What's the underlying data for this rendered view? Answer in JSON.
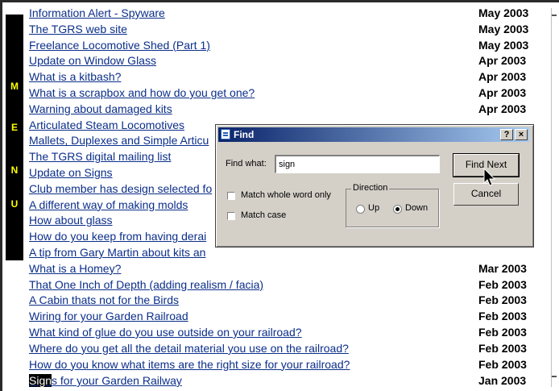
{
  "menu_letters": [
    "M",
    "E",
    "N",
    "U"
  ],
  "articles": [
    {
      "title": "Information Alert - Spyware",
      "date": "May 2003"
    },
    {
      "title": "The TGRS web site",
      "date": "May 2003"
    },
    {
      "title": "Freelance Locomotive Shed (Part 1)",
      "date": "May 2003"
    },
    {
      "title": "Update on Window Glass",
      "date": "Apr 2003"
    },
    {
      "title": "What is a kitbash?",
      "date": "Apr 2003"
    },
    {
      "title": "What is a scrapbox and how do you get one?",
      "date": "Apr 2003"
    },
    {
      "title": "Warning about damaged kits",
      "date": "Apr 2003"
    },
    {
      "title": "Articulated Steam Locomotives",
      "date": ""
    },
    {
      "title": " Mallets, Duplexes and Simple Articu",
      "date": ""
    },
    {
      "title": "The TGRS digital mailing list",
      "date": ""
    },
    {
      "title": "Update on Signs",
      "date": ""
    },
    {
      "title": "Club member has design selected fo",
      "date": ""
    },
    {
      "title": "A different way of making molds",
      "date": ""
    },
    {
      "title": "How about glass",
      "date": ""
    },
    {
      "title": "How do you keep from having derai",
      "date": ""
    },
    {
      "title": "A tip from Gary Martin about kits an",
      "date": ""
    },
    {
      "title": "What is a Homey?",
      "date": "Mar 2003"
    },
    {
      "title": "That One Inch of Depth (adding realism / facia)",
      "date": "Feb 2003"
    },
    {
      "title": "A Cabin thats not for the Birds",
      "date": "Feb 2003"
    },
    {
      "title": "Wiring for your Garden Railroad",
      "date": "Feb 2003"
    },
    {
      "title": "What kind of glue do you use outside on your railroad?",
      "date": "Feb 2003"
    },
    {
      "title": "Where do you get all the detail material you use on the railroad?",
      "date": "Feb 2003"
    },
    {
      "title": "How do you know what items are the right size for your railroad?",
      "date": "Feb 2003"
    }
  ],
  "last_article": {
    "highlight": "Sign",
    "rest": "s for your Garden Railway",
    "date": "Jan 2003"
  },
  "find_dialog": {
    "title": "Find",
    "help_label": "?",
    "close_label": "×",
    "find_what_label": "Find what:",
    "find_what_value": "sign",
    "match_whole_word_label": "Match whole word only",
    "match_whole_word_checked": false,
    "match_case_label": "Match case",
    "match_case_checked": false,
    "direction_label": "Direction",
    "up_label": "Up",
    "down_label": "Down",
    "direction_selected": "Down",
    "find_next_label": "Find Next",
    "cancel_label": "Cancel"
  },
  "colors": {
    "link": "#0b2e8a",
    "menu_bg": "#000000",
    "menu_text": "#ffff00",
    "dialog_bg": "#d4d0c8",
    "titlebar_start": "#0a246a",
    "titlebar_end": "#a6caf0"
  },
  "icons": [
    "app-window-icon",
    "arrow-cursor-icon"
  ]
}
